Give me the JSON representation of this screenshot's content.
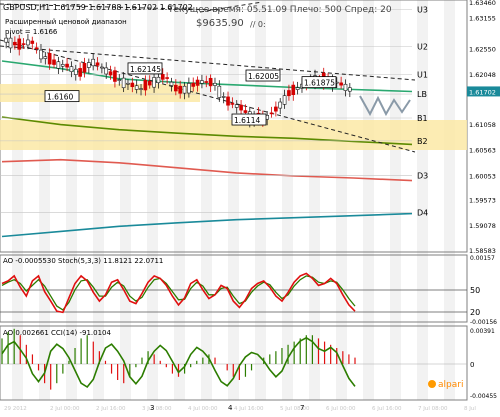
{
  "header": {
    "symbol_line": "GBPUSD,H1  1.61759 1.61788 1.61702 1.61702",
    "info_line": "Текущее время: 05.51.09  Плечо: 500  Спред: 20",
    "balance": "$9635.90",
    "range_note": "Расширенный ценовой диапазон",
    "pivot_label": "pivot = 1.6166",
    "slash_note": "// 0:"
  },
  "colors": {
    "background": "#ffffff",
    "candle_up": "#1a1a1a",
    "candle_down": "#d40000",
    "pivot_band": "#fbe9a6",
    "ma_olive": "#5c8a00",
    "ma_red": "#e05a50",
    "ma_teal": "#1a8a9a",
    "ma_green": "#2aa870",
    "osc_red": "#e01010",
    "osc_green": "#2c7d00"
  },
  "chart_data": [
    {
      "type": "candlestick",
      "title": "GBPUSD,H1",
      "ylim": [
        1.58585,
        1.6346
      ],
      "yticks": [
        "1.6346",
        "1.63155",
        "1.6285",
        "1.62545",
        "1.6224",
        "1.61935",
        "1.6163",
        "1.61325",
        "1.6102",
        "1.60715",
        "1.6041",
        "1.60105",
        "1.5980",
        "1.59495",
        "1.5919",
        "1.58885",
        "1.58585"
      ],
      "right_price_labels": [
        "1.63460",
        "1.63155",
        "1.62550",
        "1.62048",
        "1.61702",
        "1.61058",
        "1.60563",
        "1.60053",
        "1.59573",
        "1.59078",
        "1.58583"
      ],
      "current_price": "1.61702",
      "price_path": [
        1.6272,
        1.626,
        1.627,
        1.624,
        1.6225,
        1.622,
        1.6205,
        1.623,
        1.6215,
        1.6195,
        1.6185,
        1.6175,
        1.619,
        1.62,
        1.617,
        1.618,
        1.619,
        1.6185,
        1.615,
        1.614,
        1.612,
        1.6115,
        1.6135,
        1.6165,
        1.618,
        1.6195,
        1.6192,
        1.6188,
        1.6175
      ],
      "price_labels": [
        "1.6160",
        "1.62145",
        "1.62005",
        "1.61875",
        "1.6114"
      ],
      "levels": [
        {
          "name": "U3",
          "value": 1.6331
        },
        {
          "name": "U2",
          "value": 1.6259
        },
        {
          "name": "U1",
          "value": 1.6203
        },
        {
          "name": "LB",
          "value": 1.6165
        },
        {
          "name": "B1",
          "value": 1.6118
        },
        {
          "name": "B2",
          "value": 1.6073
        },
        {
          "name": "D3",
          "value": 1.6005
        },
        {
          "name": "D4",
          "value": 1.5932
        }
      ],
      "moving_averages": [
        {
          "color": "olive",
          "values": [
            1.612,
            1.6105,
            1.6095,
            1.6088,
            1.6082,
            1.6078,
            1.6072,
            1.6066
          ]
        },
        {
          "color": "red",
          "values": [
            1.6032,
            1.6036,
            1.603,
            1.602,
            1.601,
            1.6004,
            1.6,
            1.5995
          ]
        },
        {
          "color": "teal",
          "values": [
            1.5885,
            1.5895,
            1.5905,
            1.5912,
            1.5918,
            1.5922,
            1.5926,
            1.593
          ]
        },
        {
          "color": "green",
          "values": [
            1.623,
            1.6215,
            1.6195,
            1.6188,
            1.6183,
            1.6178,
            1.6174,
            1.617
          ]
        }
      ]
    },
    {
      "type": "line",
      "title": "AO -0.0005530  Stoch(5,3,3) 11.8121 22.0711",
      "ylim": [
        -0.00156,
        0.00157
      ],
      "axis_labels": [
        "0.00157",
        "50",
        "20",
        "-0.00156"
      ],
      "stoch_main": [
        58,
        62,
        70,
        52,
        38,
        62,
        70,
        45,
        30,
        14,
        12,
        35,
        58,
        70,
        62,
        44,
        30,
        40,
        60,
        64,
        48,
        30,
        26,
        42,
        60,
        70,
        66,
        55,
        38,
        24,
        35,
        58,
        64,
        48,
        34,
        40,
        55,
        50,
        30,
        20,
        32,
        50,
        58,
        62,
        52,
        38,
        30,
        44,
        60,
        70,
        74,
        66,
        55,
        58,
        66,
        58,
        40,
        24,
        14
      ],
      "stoch_signal": [
        55,
        60,
        64,
        58,
        46,
        55,
        64,
        54,
        38,
        22,
        16,
        28,
        48,
        62,
        64,
        52,
        38,
        38,
        52,
        60,
        54,
        38,
        30,
        36,
        52,
        64,
        66,
        58,
        45,
        32,
        33,
        50,
        60,
        54,
        40,
        40,
        50,
        52,
        38,
        26,
        30,
        44,
        54,
        60,
        56,
        44,
        34,
        40,
        54,
        64,
        70,
        68,
        60,
        58,
        62,
        60,
        48,
        34,
        22
      ]
    },
    {
      "type": "line",
      "title": "AO 0.002661  CCI(14) -91.0104",
      "ylim": [
        -0.00455,
        0.00391
      ],
      "axis_labels": [
        "0.00391",
        "0",
        "-0.00455"
      ],
      "cci": [
        32,
        60,
        70,
        45,
        18,
        -30,
        -55,
        -28,
        40,
        62,
        48,
        20,
        -20,
        -60,
        -72,
        -48,
        6,
        50,
        62,
        40,
        10,
        -40,
        -62,
        -38,
        10,
        40,
        58,
        42,
        8,
        -26,
        -8,
        30,
        52,
        40,
        18,
        -20,
        -55,
        -68,
        -45,
        -5,
        22,
        36,
        30,
        10,
        -18,
        -40,
        -22,
        20,
        50,
        72,
        82,
        70,
        48,
        40,
        52,
        36,
        -5,
        -45,
        -70
      ],
      "ao_hist": [
        8,
        10,
        11,
        9,
        6,
        3,
        -2,
        -6,
        -8,
        -6,
        -3,
        1,
        5,
        8,
        9,
        7,
        4,
        1,
        -3,
        -5,
        -6,
        -4,
        -1,
        2,
        4,
        3,
        1,
        -1,
        -3,
        -4,
        -3,
        -1,
        1,
        2,
        3,
        2,
        0,
        -2,
        -4,
        -5,
        -4,
        -2,
        0,
        2,
        3,
        4,
        5,
        6,
        7,
        8,
        9,
        9,
        8,
        7,
        6,
        5,
        4,
        3,
        2
      ]
    }
  ],
  "x_axis_labels": [
    "29 2012",
    "2 Jul 00:00",
    "2 Jul 16:00",
    "3 Jul 08:00",
    "4 Jul 00:00",
    "4 Jul 16:00",
    "5 Jul 08:00",
    "6 Jul 00:00",
    "6 Jul 16:00",
    "7 Jul 08:00",
    "8 Jul"
  ],
  "x_axis_marks": [
    "3",
    "4",
    "7"
  ],
  "brand": "alpari"
}
